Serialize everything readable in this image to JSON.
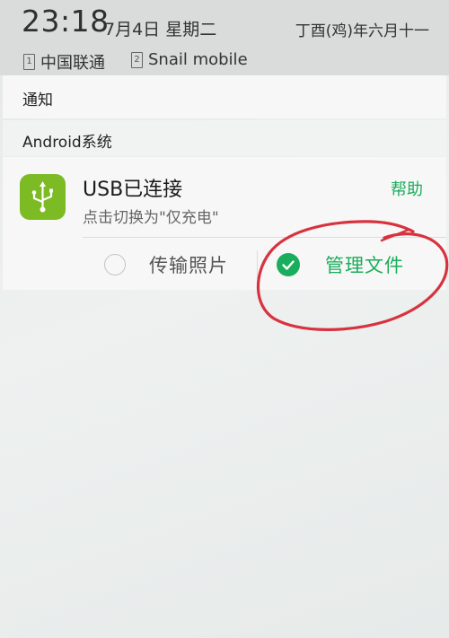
{
  "status_bar": {
    "time": "23:18",
    "date": "7月4日 星期二",
    "lunar_date": "丁酉(鸡)年六月十一"
  },
  "carriers": [
    {
      "slot": "1",
      "name": "中国联通"
    },
    {
      "slot": "2",
      "name": "Snail mobile"
    }
  ],
  "notifications": {
    "header_label": "通知",
    "group_label": "Android系统"
  },
  "usb_notification": {
    "title": "USB已连接",
    "subtitle": "点击切换为\"仅充电\"",
    "help_label": "帮助",
    "options": [
      {
        "label": "传输照片",
        "selected": false
      },
      {
        "label": "管理文件",
        "selected": true
      }
    ]
  },
  "colors": {
    "accent_green": "#1aad5b",
    "app_icon_green": "#7dbb25",
    "annotation_red": "#d8323f"
  },
  "icons": {
    "app_icon": "usb-icon",
    "selected_option": "checkmark-icon"
  }
}
